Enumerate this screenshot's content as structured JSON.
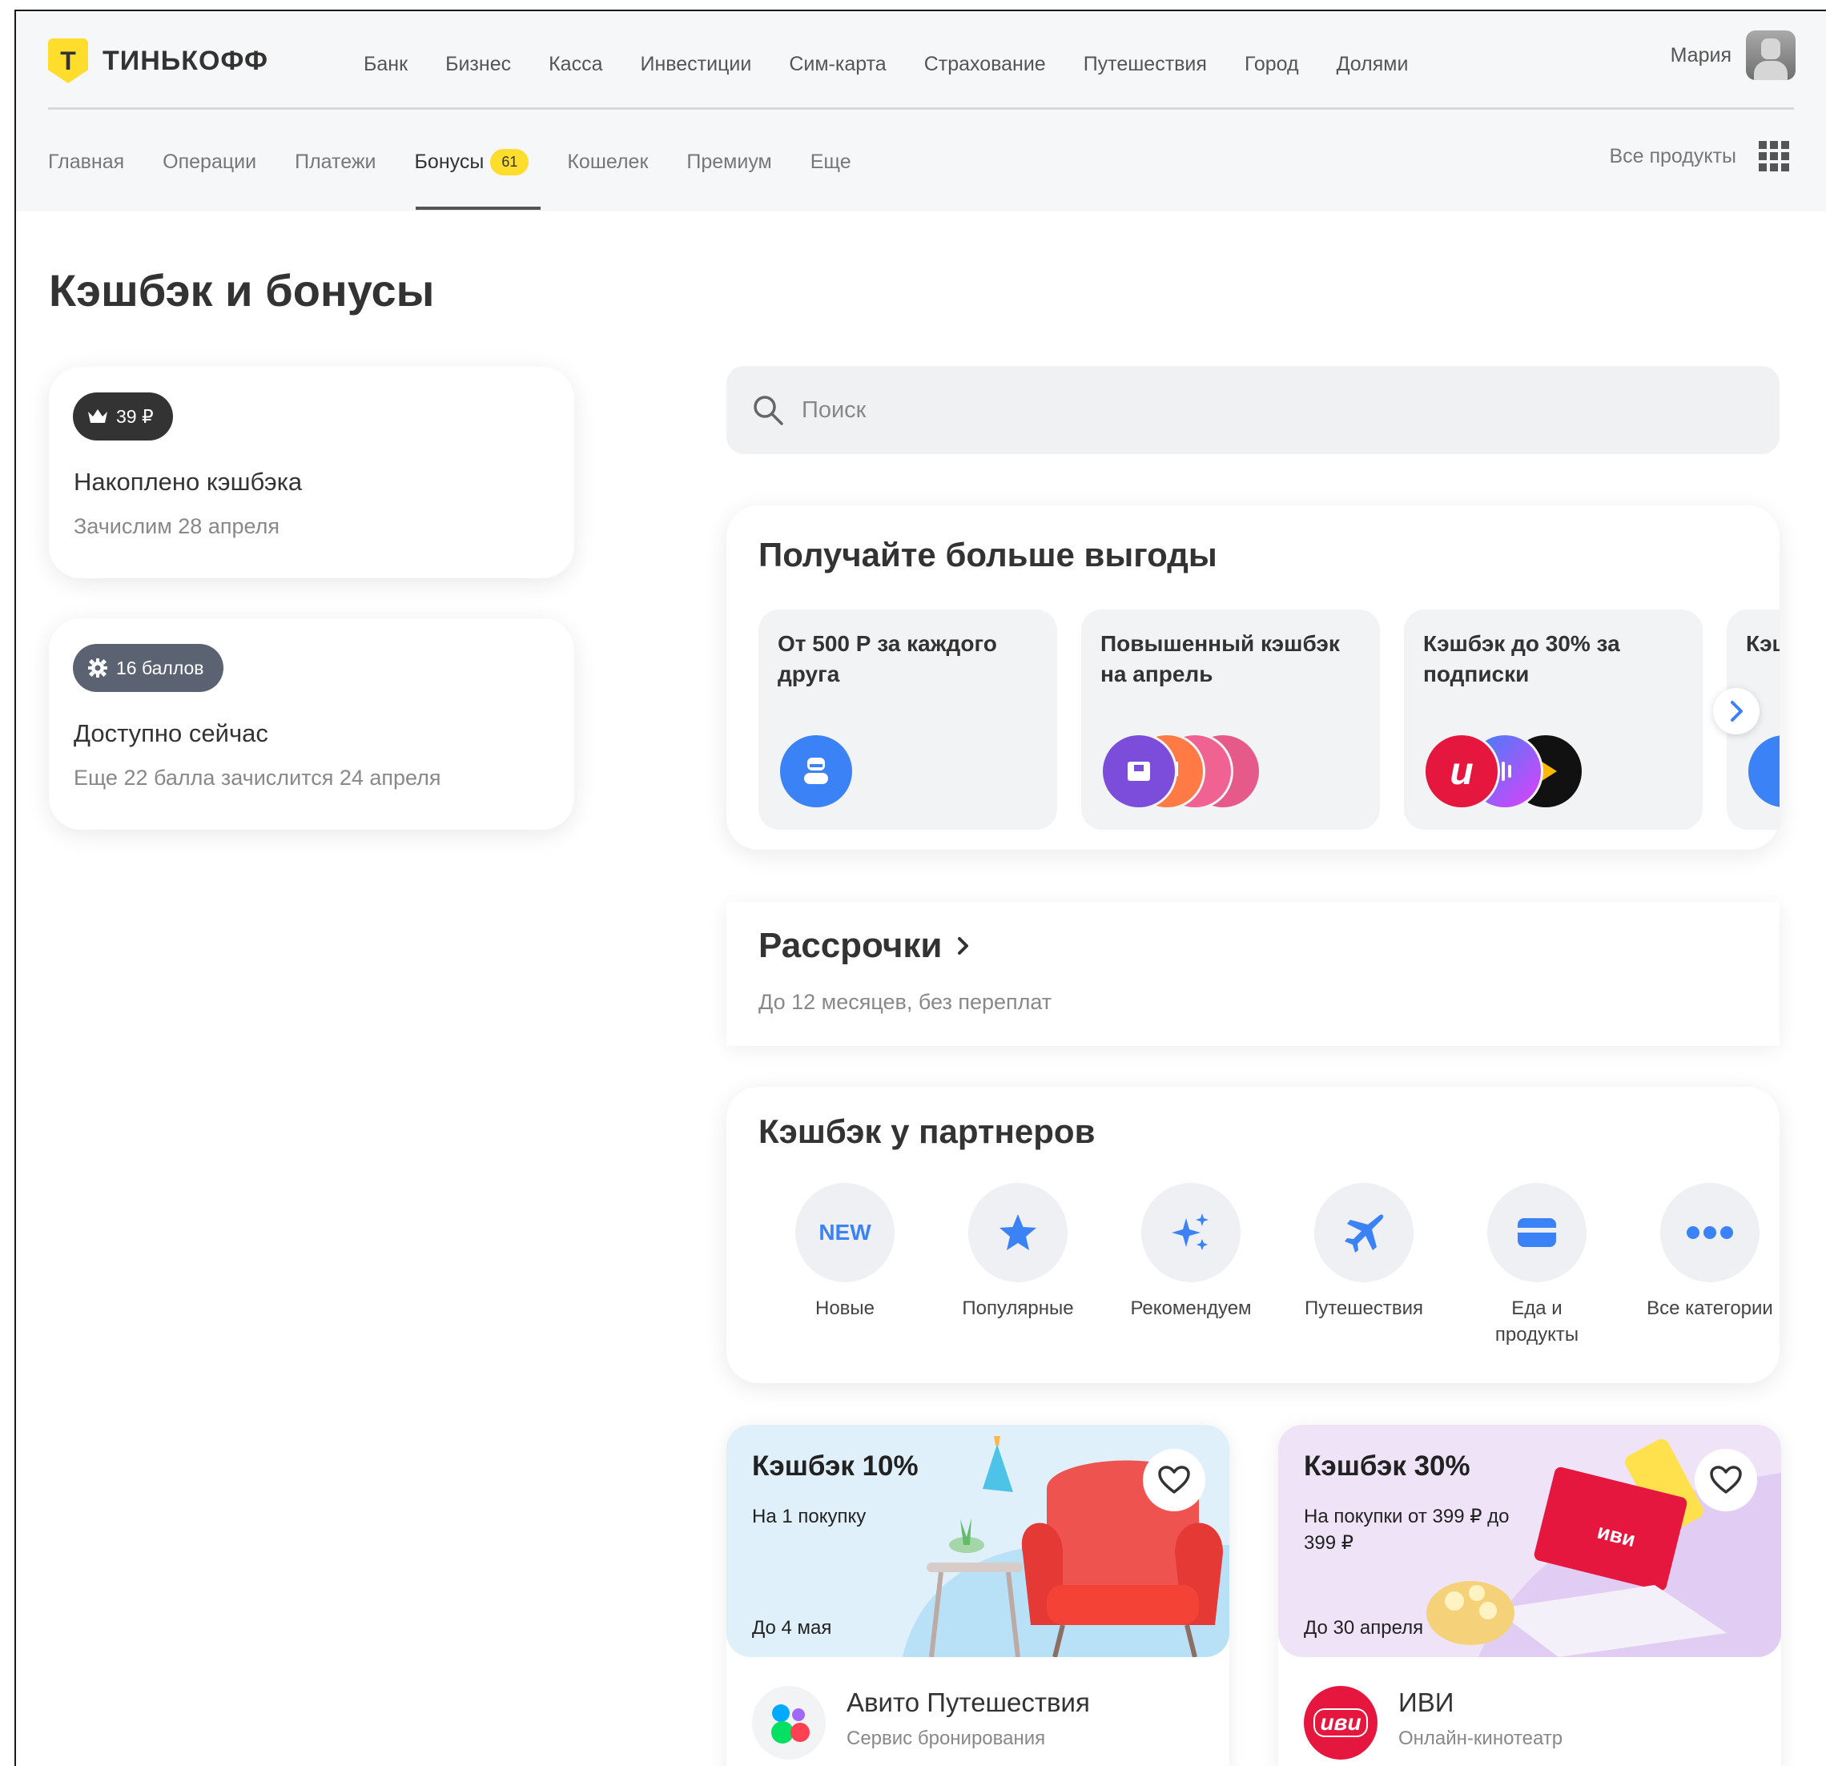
{
  "header": {
    "logo_text": "ТИНЬКОФФ",
    "logo_letter": "Т",
    "top_nav": [
      "Банк",
      "Бизнес",
      "Касса",
      "Инвестиции",
      "Сим-карта",
      "Страхование",
      "Путешествия",
      "Город",
      "Долями"
    ],
    "user_name": "Мария",
    "sub_nav": [
      {
        "label": "Главная"
      },
      {
        "label": "Операции"
      },
      {
        "label": "Платежи"
      },
      {
        "label": "Бонусы",
        "badge": "61",
        "active": true
      },
      {
        "label": "Кошелек"
      },
      {
        "label": "Премиум"
      },
      {
        "label": "Еще"
      }
    ],
    "all_products": "Все продукты"
  },
  "page_title": "Кэшбэк и бонусы",
  "cashback_card": {
    "amount": "39 ₽",
    "title": "Накоплено кэшбэка",
    "subtitle": "Зачислим 28 апреля"
  },
  "points_card": {
    "amount": "16 баллов",
    "title": "Доступно сейчас",
    "subtitle": "Еще 22 балла зачислится 24 апреля"
  },
  "search": {
    "placeholder": "Поиск"
  },
  "promos": {
    "title": "Получайте больше выгоды",
    "items": [
      {
        "text": "От 500 Р за каждого друга"
      },
      {
        "text": "Повышенный кэшбэк на апрель"
      },
      {
        "text": "Кэшбэк до 30% за подписки"
      },
      {
        "text": "Кэш за п"
      }
    ]
  },
  "installments": {
    "title": "Рассрочки",
    "subtitle": "До 12 месяцев, без переплат"
  },
  "partners": {
    "title": "Кэшбэк у партнеров",
    "categories": [
      {
        "label": "Новые",
        "icon": "new-icon",
        "icon_text": "NEW"
      },
      {
        "label": "Популярные",
        "icon": "star-icon"
      },
      {
        "label": "Рекомендуем",
        "icon": "sparkle-icon"
      },
      {
        "label": "Путешествия",
        "icon": "plane-icon"
      },
      {
        "label": "Еда и продукты",
        "icon": "card-icon"
      },
      {
        "label": "Все категории",
        "icon": "dots-icon"
      }
    ]
  },
  "offers": [
    {
      "title": "Кэшбэк 10%",
      "desc": "На 1 покупку",
      "until": "До 4 мая",
      "partner": "Авито Путешествия",
      "partner_sub": "Сервис бронирования",
      "banner_color": "#dff0fb"
    },
    {
      "title": "Кэшбэк 30%",
      "desc": "На покупки от 399 ₽ до 399 ₽",
      "until": "До 30 апреля",
      "partner": "ИВИ",
      "partner_sub": "Онлайн-кинотеатр",
      "logo_text": "иви",
      "banner_color": "#efe3f8"
    }
  ],
  "colors": {
    "accent_yellow": "#ffdd2d",
    "accent_blue": "#3b82f6",
    "ivi_red": "#e5173f"
  }
}
